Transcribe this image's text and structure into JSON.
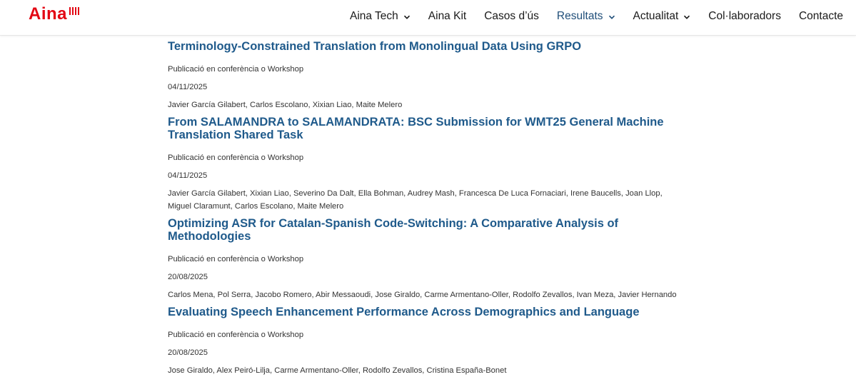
{
  "brand": {
    "logo_text": "Aina",
    "color": "#e30613"
  },
  "nav": {
    "items": [
      {
        "label": "Aina Tech",
        "dropdown": true,
        "active": false
      },
      {
        "label": "Aina Kit",
        "dropdown": false,
        "active": false
      },
      {
        "label": "Casos d’ús",
        "dropdown": false,
        "active": false
      },
      {
        "label": "Resultats",
        "dropdown": true,
        "active": true
      },
      {
        "label": "Actualitat",
        "dropdown": true,
        "active": false
      },
      {
        "label": "Col·laboradors",
        "dropdown": false,
        "active": false
      },
      {
        "label": "Contacte",
        "dropdown": false,
        "active": false
      }
    ],
    "active_color": "#1f4e79"
  },
  "publications": [
    {
      "title": "Terminology-Constrained Translation from Monolingual Data Using GRPO",
      "type": "Publicació en conferència o Workshop",
      "date": "04/11/2025",
      "authors": "Javier García Gilabert, Carlos Escolano, Xixian Liao, Maite Melero"
    },
    {
      "title": "From SALAMANDRA to SALAMANDRATA: BSC Submission for WMT25 General Machine Translation Shared Task",
      "type": "Publicació en conferència o Workshop",
      "date": "04/11/2025",
      "authors": "Javier García Gilabert, Xixian Liao, Severino Da Dalt, Ella Bohman, Audrey Mash, Francesca De Luca Fornaciari, Irene Baucells, Joan Llop, Miguel Claramunt, Carlos Escolano, Maite Melero"
    },
    {
      "title": "Optimizing ASR for Catalan-Spanish Code-Switching: A Comparative Analysis of Methodologies",
      "type": "Publicació en conferència o Workshop",
      "date": "20/08/2025",
      "authors": "Carlos Mena, Pol Serra, Jacobo Romero, Abir Messaoudi, Jose Giraldo, Carme Armentano-Oller, Rodolfo Zevallos, Ivan Meza, Javier Hernando"
    },
    {
      "title": "Evaluating Speech Enhancement Performance Across Demographics and Language",
      "type": "Publicació en conferència o Workshop",
      "date": "20/08/2025",
      "authors": "Jose Giraldo, Alex Peiró-Lilja, Carme Armentano-Oller, Rodolfo Zevallos, Cristina España-Bonet"
    }
  ],
  "link_color": "#1f5a8b"
}
